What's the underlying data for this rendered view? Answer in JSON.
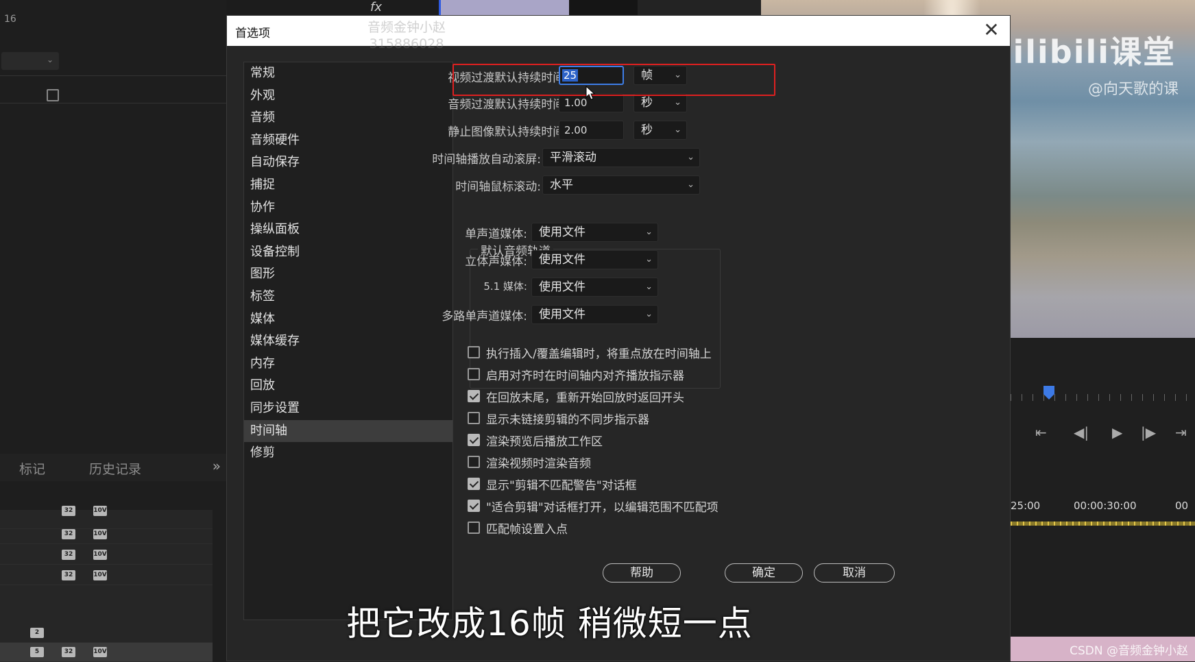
{
  "background": {
    "left_number": "16",
    "panel_tabs": [
      "标记",
      "历史记录"
    ],
    "panel_more": "»",
    "fx_label": "fx",
    "logo_text": "bilibili课堂",
    "logo_handle": "@向天歌的课",
    "timecode_left": "25:00",
    "timecode_right": "00:00:30:00",
    "timecode_far": "00",
    "csdn_watermark": "CSDN @音频金钟小赵",
    "badges": [
      "32",
      "10V",
      "2",
      "5"
    ]
  },
  "dialog": {
    "title": "首选项",
    "close": "✕",
    "watermark_line1": "音频金钟小赵",
    "watermark_line2": "315886028",
    "categories": [
      "常规",
      "外观",
      "音频",
      "音频硬件",
      "自动保存",
      "捕捉",
      "协作",
      "操纵面板",
      "设备控制",
      "图形",
      "标签",
      "媒体",
      "媒体缓存",
      "内存",
      "回放",
      "同步设置",
      "时间轴",
      "修剪"
    ],
    "active_category": "时间轴",
    "timeline": {
      "video_transition_label": "视频过渡默认持续时间:",
      "video_transition_value": "25",
      "video_transition_unit": "帧",
      "audio_transition_label": "音频过渡默认持续时间:",
      "audio_transition_value": "1.00",
      "audio_transition_unit": "秒",
      "still_image_label": "静止图像默认持续时间:",
      "still_image_value": "2.00",
      "still_image_unit": "秒",
      "autoscroll_label": "时间轴播放自动滚屏:",
      "autoscroll_value": "平滑滚动",
      "mousescroll_label": "时间轴鼠标滚动:",
      "mousescroll_value": "水平",
      "audio_tracks_group": "默认音频轨道",
      "mono_label": "单声道媒体:",
      "mono_value": "使用文件",
      "stereo_label": "立体声媒体:",
      "stereo_value": "使用文件",
      "surround_label": "5.1 媒体:",
      "surround_value": "使用文件",
      "multimono_label": "多路单声道媒体:",
      "multimono_value": "使用文件"
    },
    "checkboxes": [
      {
        "label": "执行插入/覆盖编辑时，将重点放在时间轴上",
        "checked": false
      },
      {
        "label": "启用对齐时在时间轴内对齐播放指示器",
        "checked": false
      },
      {
        "label": "在回放末尾，重新开始回放时返回开头",
        "checked": true
      },
      {
        "label": "显示未链接剪辑的不同步指示器",
        "checked": false
      },
      {
        "label": "渲染预览后播放工作区",
        "checked": true
      },
      {
        "label": "渲染视频时渲染音频",
        "checked": false
      },
      {
        "label": "显示\"剪辑不匹配警告\"对话框",
        "checked": true
      },
      {
        "label": "\"适合剪辑\"对话框打开，以编辑范围不匹配项",
        "checked": true
      },
      {
        "label": "匹配帧设置入点",
        "checked": false
      }
    ],
    "buttons": {
      "help": "帮助",
      "ok": "确定",
      "cancel": "取消"
    }
  },
  "subtitle": "把它改成16帧  稍微短一点",
  "colors": {
    "highlight_box": "#e02020",
    "selection": "#2d63c9",
    "accent_playhead": "#3d7ae6"
  }
}
